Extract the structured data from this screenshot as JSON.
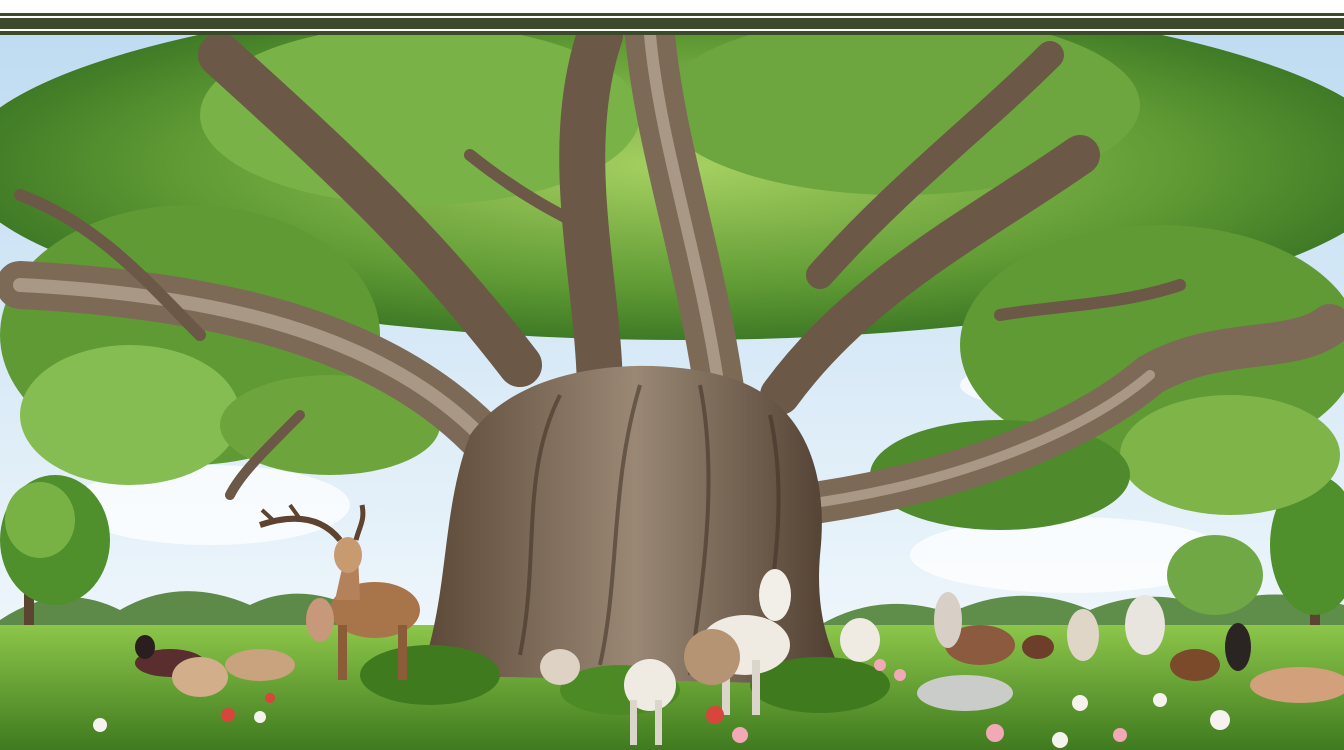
{
  "scene": {
    "palette": {
      "sky_top": "#cfe6f6",
      "sky_bottom": "#eef6fb",
      "foliage_dark": "#2f6a22",
      "foliage_mid": "#5f9a34",
      "foliage_light": "#9cc95a",
      "trunk_dark": "#4b3a2c",
      "trunk_mid": "#7d6a56",
      "trunk_light": "#a89885",
      "grass_dark": "#3f7a1f",
      "grass_light": "#7fbf3d",
      "deer": "#a8744a",
      "goat_white": "#efeae2",
      "flower_red": "#d8453a",
      "flower_pink": "#f1a9b6",
      "flower_white": "#f6f3ee"
    },
    "elements": [
      "giant-tree",
      "background-trees",
      "meadow",
      "deer",
      "goats",
      "sheep",
      "wildflowers",
      "rocks"
    ]
  }
}
